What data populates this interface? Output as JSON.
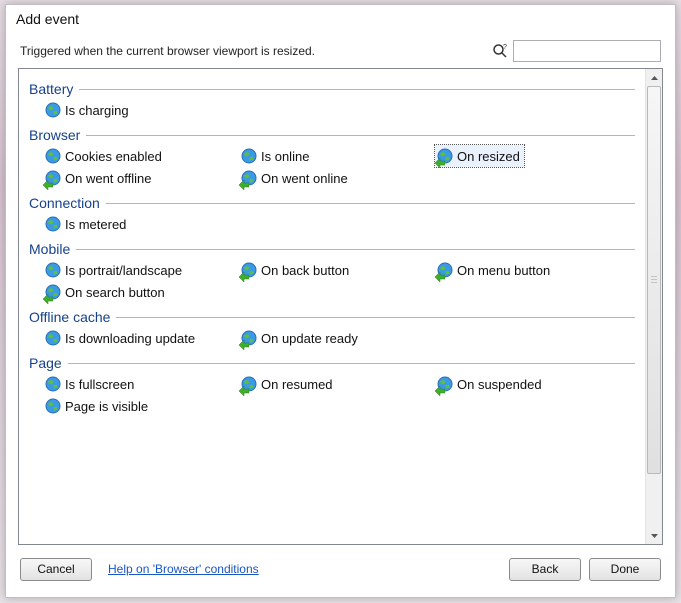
{
  "dialog": {
    "title": "Add event"
  },
  "description": "Triggered when the current browser viewport is resized.",
  "search": {
    "placeholder": ""
  },
  "selected_id": "browser-on-resized",
  "categories": [
    {
      "id": "battery",
      "title": "Battery",
      "items": [
        {
          "id": "battery-is-charging",
          "label": "Is charging",
          "trigger": false
        }
      ]
    },
    {
      "id": "browser",
      "title": "Browser",
      "items": [
        {
          "id": "browser-cookies-enabled",
          "label": "Cookies enabled",
          "trigger": false
        },
        {
          "id": "browser-is-online",
          "label": "Is online",
          "trigger": false
        },
        {
          "id": "browser-on-resized",
          "label": "On resized",
          "trigger": true
        },
        {
          "id": "browser-on-went-offline",
          "label": "On went offline",
          "trigger": true
        },
        {
          "id": "browser-on-went-online",
          "label": "On went online",
          "trigger": true
        }
      ]
    },
    {
      "id": "connection",
      "title": "Connection",
      "items": [
        {
          "id": "connection-is-metered",
          "label": "Is metered",
          "trigger": false
        }
      ]
    },
    {
      "id": "mobile",
      "title": "Mobile",
      "items": [
        {
          "id": "mobile-is-portrait-landscape",
          "label": "Is portrait/landscape",
          "trigger": false
        },
        {
          "id": "mobile-on-back-button",
          "label": "On back button",
          "trigger": true
        },
        {
          "id": "mobile-on-menu-button",
          "label": "On menu button",
          "trigger": true
        },
        {
          "id": "mobile-on-search-button",
          "label": "On search button",
          "trigger": true
        }
      ]
    },
    {
      "id": "offline-cache",
      "title": "Offline cache",
      "items": [
        {
          "id": "offline-is-downloading-update",
          "label": "Is downloading update",
          "trigger": false
        },
        {
          "id": "offline-on-update-ready",
          "label": "On update ready",
          "trigger": true
        }
      ]
    },
    {
      "id": "page",
      "title": "Page",
      "items": [
        {
          "id": "page-is-fullscreen",
          "label": "Is fullscreen",
          "trigger": false
        },
        {
          "id": "page-on-resumed",
          "label": "On resumed",
          "trigger": true
        },
        {
          "id": "page-on-suspended",
          "label": "On suspended",
          "trigger": true
        },
        {
          "id": "page-page-is-visible",
          "label": "Page is visible",
          "trigger": false
        }
      ]
    }
  ],
  "footer": {
    "cancel": "Cancel",
    "help_link": "Help on 'Browser' conditions",
    "back": "Back",
    "done": "Done"
  }
}
